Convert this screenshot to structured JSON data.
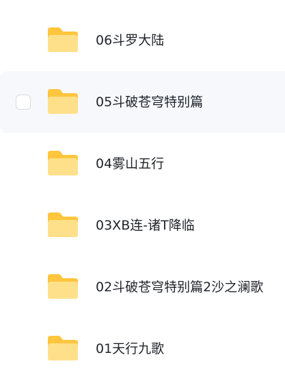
{
  "folders": [
    {
      "name": "06斗罗大陆"
    },
    {
      "name": "05斗破苍穹特别篇"
    },
    {
      "name": "04雾山五行"
    },
    {
      "name": "03XB连-诸T降临"
    },
    {
      "name": "02斗破苍穹特别篇2沙之澜歌"
    },
    {
      "name": "01天行九歌"
    }
  ],
  "hovered_index": 1,
  "icon": "folder-icon",
  "colors": {
    "folder_back": "#FFC53D",
    "folder_front_top": "#FFE58F",
    "folder_front_bottom": "#FFD666",
    "hover_row_bg": "#F6F8FB",
    "text": "#1F2329"
  }
}
